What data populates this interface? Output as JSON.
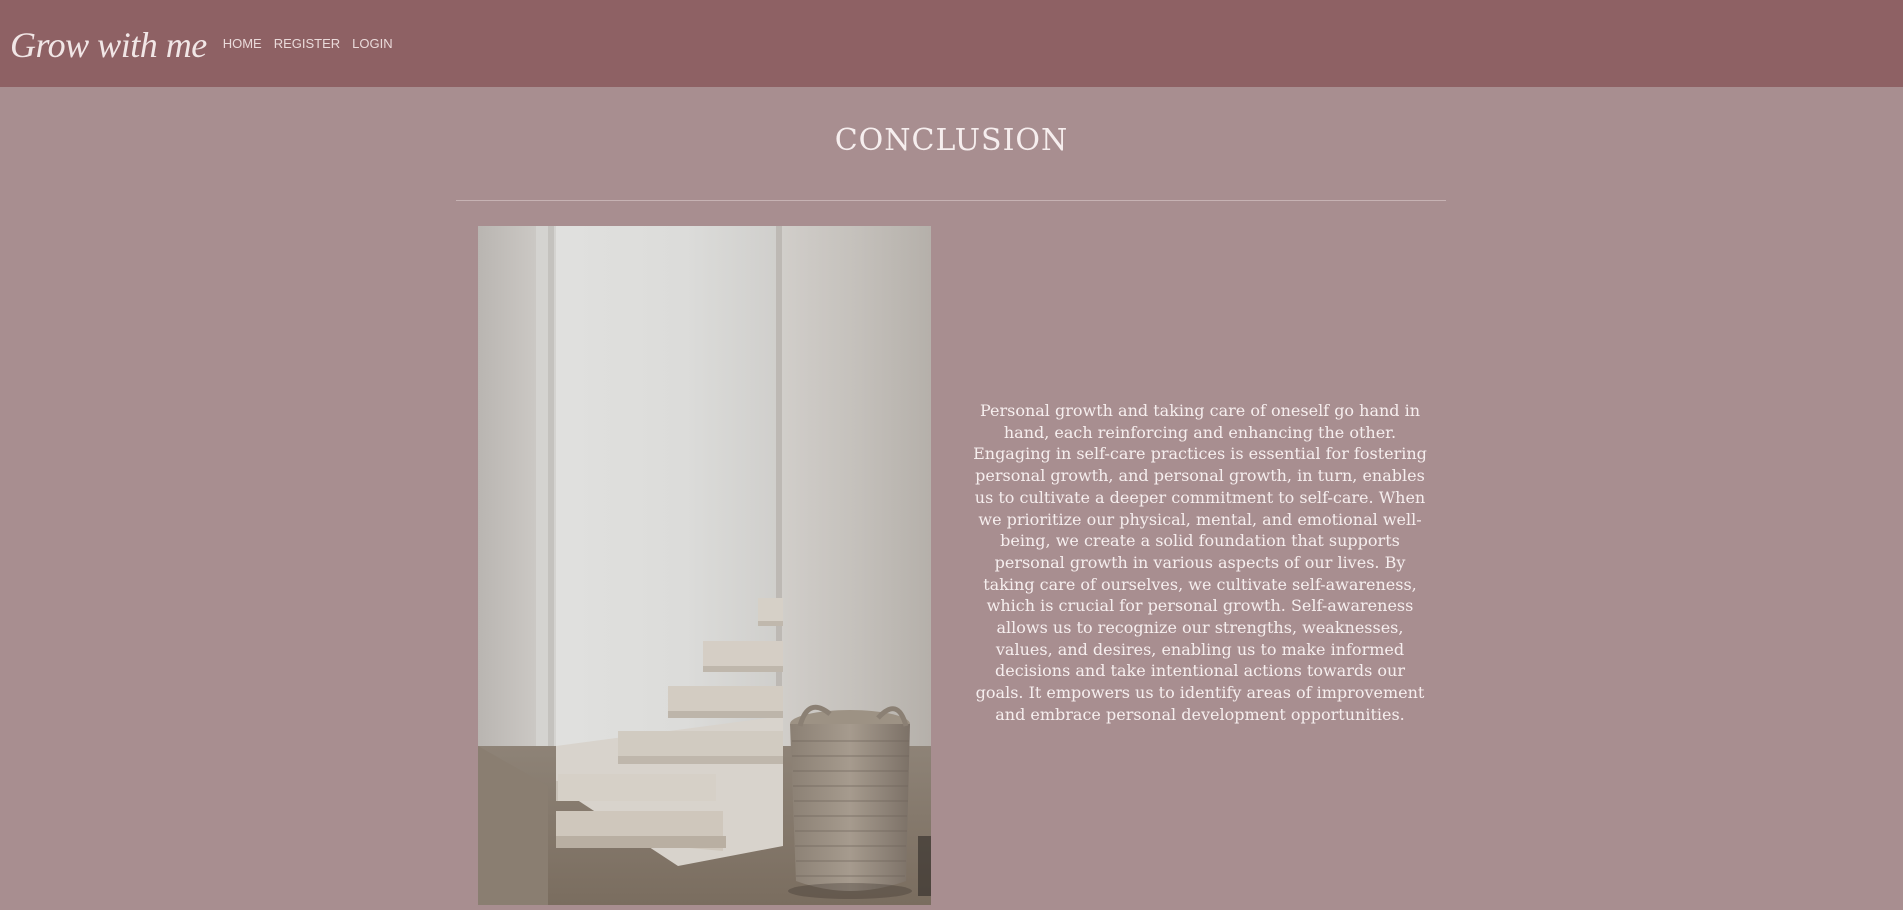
{
  "navbar": {
    "brand": "Grow with me",
    "links": [
      {
        "label": "HOME"
      },
      {
        "label": "REGISTER"
      },
      {
        "label": "LOGIN"
      }
    ],
    "background": "#8e6164"
  },
  "main": {
    "title": "CONCLUSION",
    "paragraph": "Personal growth and taking care of oneself go hand in hand, each reinforcing and enhancing the other. Engaging in self-care practices is essential for fostering personal growth, and personal growth, in turn, enables us to cultivate a deeper commitment to self-care. When we prioritize our physical, mental, and emotional well-being, we create a solid foundation that supports personal growth in various aspects of our lives. By taking care of ourselves, we cultivate self-awareness, which is crucial for personal growth. Self-awareness allows us to recognize our strengths, weaknesses, values, and desires, enabling us to make informed decisions and take intentional actions towards our goals. It empowers us to identify areas of improvement and embrace personal development opportunities.",
    "background": "#a88e90"
  }
}
